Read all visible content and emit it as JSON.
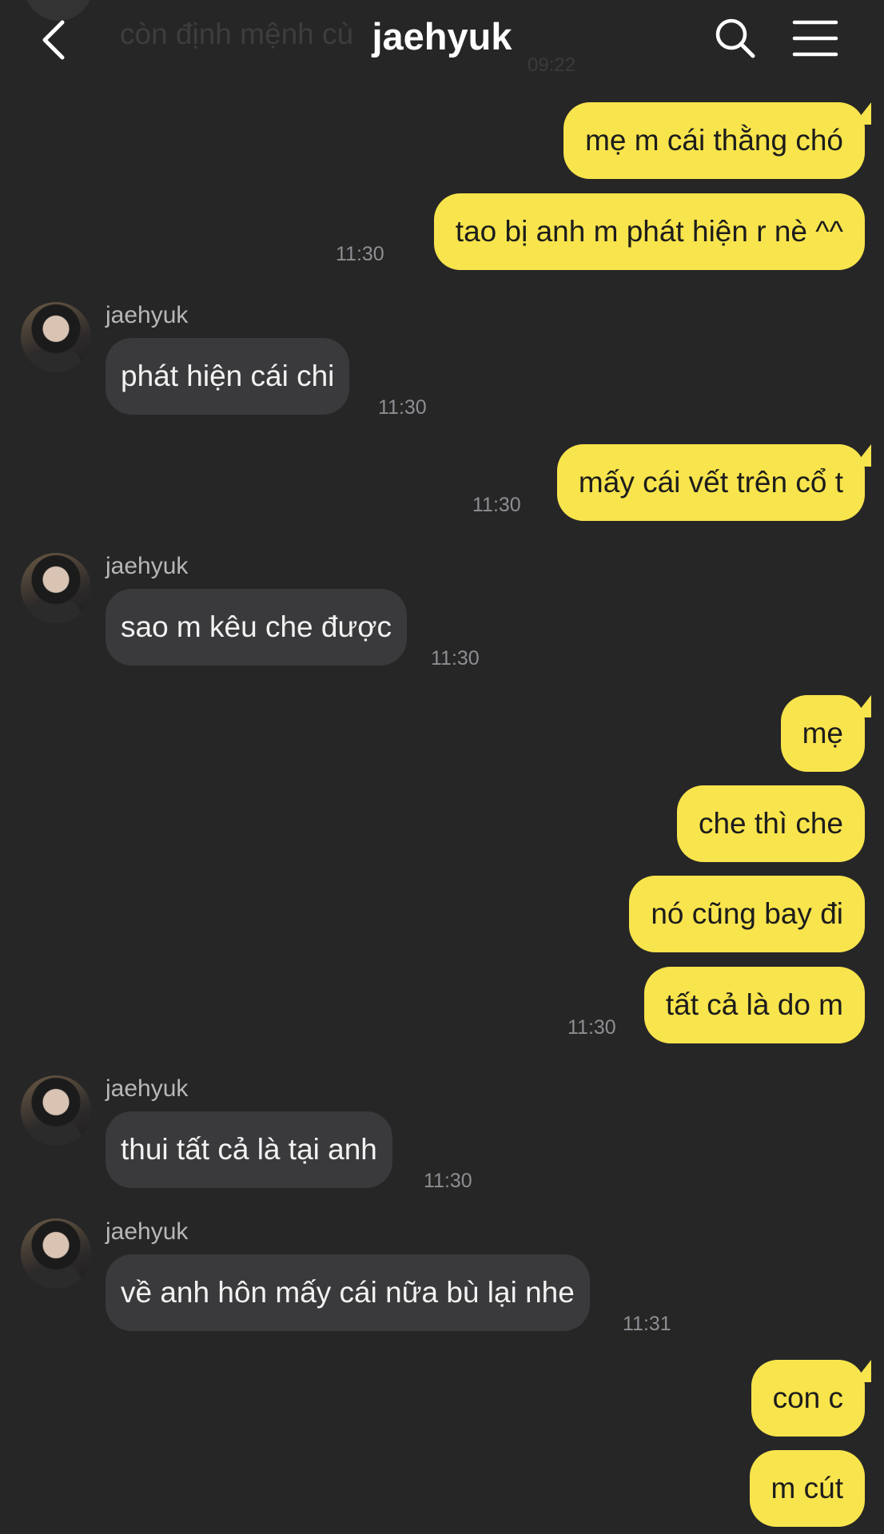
{
  "header": {
    "title": "jaehyuk",
    "ghost_preview_text": "còn định mệnh cù",
    "ghost_preview_time": "09:22"
  },
  "messages": [
    {
      "dir": "out",
      "text": "mẹ m cái thằng chó"
    },
    {
      "dir": "out",
      "text": "tao bị anh m phát hiện r nè ^^",
      "time": "11:30"
    },
    {
      "dir": "in",
      "sender": "jaehyuk",
      "text": "phát hiện cái chi",
      "time": "11:30"
    },
    {
      "dir": "out",
      "text": "mấy cái vết trên cổ t",
      "time": "11:30"
    },
    {
      "dir": "in",
      "sender": "jaehyuk",
      "text": "sao m kêu che được",
      "time": "11:30"
    },
    {
      "dir": "out",
      "text": "mẹ"
    },
    {
      "dir": "out",
      "text": "che thì che"
    },
    {
      "dir": "out",
      "text": "nó cũng bay đi"
    },
    {
      "dir": "out",
      "text": "tất cả là do m",
      "time": "11:30"
    },
    {
      "dir": "in",
      "sender": "jaehyuk",
      "text": "thui tất cả là tại anh",
      "time": "11:30"
    },
    {
      "dir": "in",
      "sender": "jaehyuk",
      "text": "về anh hôn mấy cái nữa bù lại nhe",
      "time": "11:31"
    },
    {
      "dir": "out",
      "text": "con c"
    },
    {
      "dir": "out",
      "text": "m cút"
    }
  ],
  "colors": {
    "background": "#262627",
    "outgoing_bubble": "#f8e44c",
    "incoming_bubble": "#3a3a3c",
    "timestamp": "#8e8e93"
  },
  "icons": [
    "back-chevron-icon",
    "search-icon",
    "menu-icon"
  ]
}
